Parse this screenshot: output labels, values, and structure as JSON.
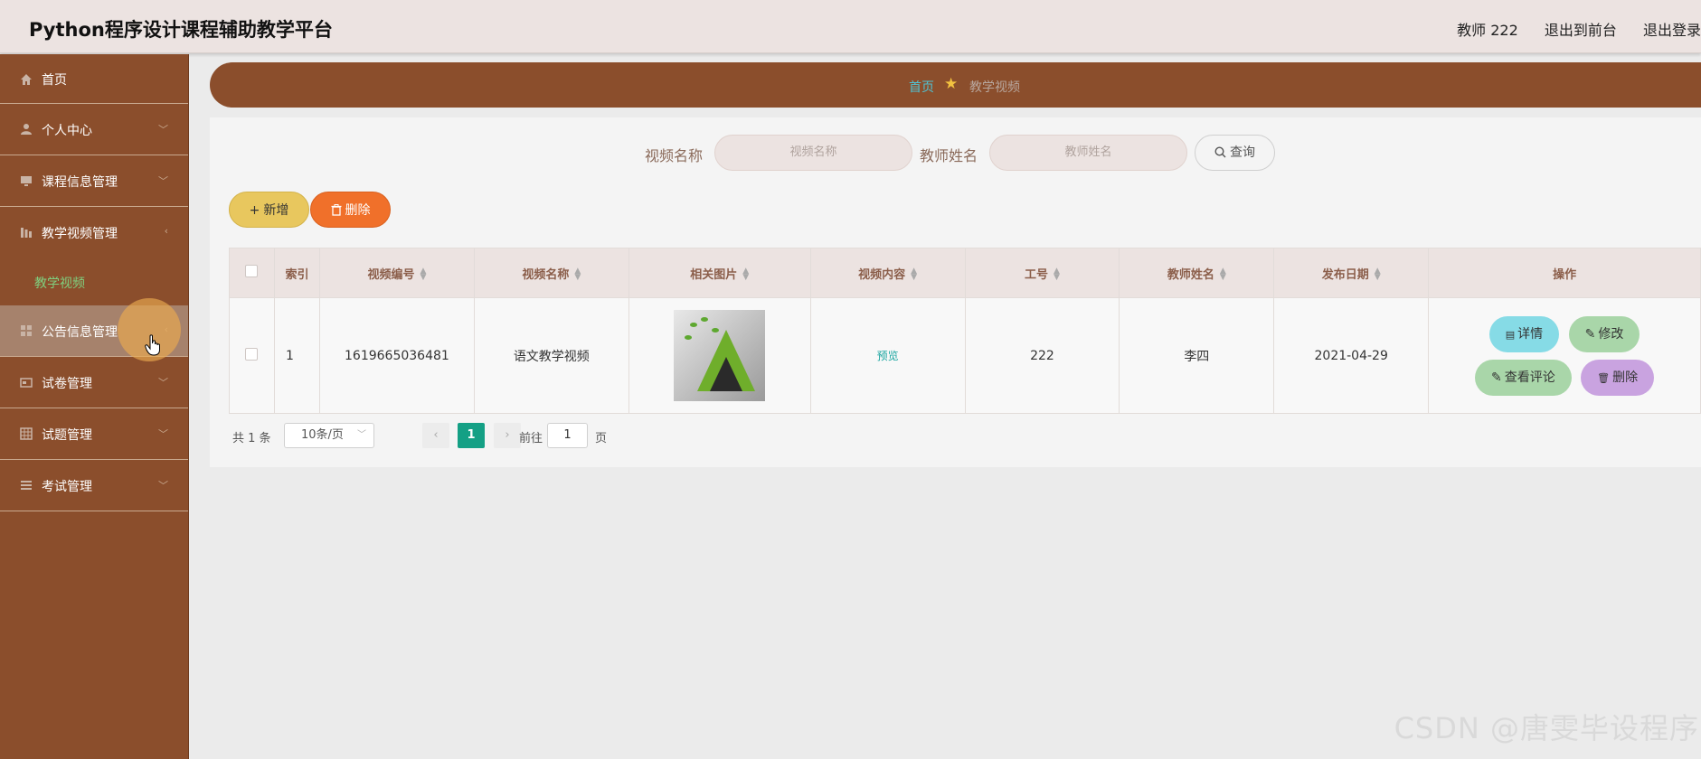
{
  "header": {
    "title": "Python程序设计课程辅助教学平台",
    "user_label": "教师 222",
    "back_link": "退出到前台",
    "logout_link": "退出登录"
  },
  "sidebar": {
    "items": [
      {
        "label": "首页",
        "icon": "home-icon"
      },
      {
        "label": "个人中心",
        "icon": "user-icon"
      },
      {
        "label": "课程信息管理",
        "icon": "monitor-icon"
      },
      {
        "label": "教学视频管理",
        "icon": "chart-icon"
      },
      {
        "label": "公告信息管理",
        "icon": "grid-icon"
      },
      {
        "label": "试卷管理",
        "icon": "card-icon"
      },
      {
        "label": "试题管理",
        "icon": "table-icon"
      },
      {
        "label": "考试管理",
        "icon": "list-icon"
      }
    ],
    "active_sub": "教学视频"
  },
  "breadcrumb": {
    "home": "首页",
    "current": "教学视频"
  },
  "search": {
    "video_name_label": "视频名称",
    "video_name_placeholder": "视频名称",
    "teacher_label": "教师姓名",
    "teacher_placeholder": "教师姓名",
    "query_button": "查询"
  },
  "toolbar": {
    "add_label": "新增",
    "delete_label": "删除"
  },
  "table": {
    "columns": [
      "索引",
      "视频编号",
      "视频名称",
      "相关图片",
      "视频内容",
      "工号",
      "教师姓名",
      "发布日期",
      "操作"
    ],
    "rows": [
      {
        "index": "1",
        "video_no": "1619665036481",
        "video_name": "语文教学视频",
        "content_link": "预览",
        "staff_no": "222",
        "teacher": "李四",
        "date": "2021-04-29"
      }
    ],
    "actions": {
      "detail": "详情",
      "edit": "修改",
      "comments": "查看评论",
      "delete": "删除"
    }
  },
  "pagination": {
    "total": "共 1 条",
    "page_size": "10条/页",
    "current_page": "1",
    "goto_label": "前往",
    "goto_value": "1",
    "page_word": "页"
  },
  "watermark": "CSDN @唐雯毕设程序",
  "colors": {
    "sidebar": "#8b4e2c",
    "header": "#ece3e1",
    "accent_green": "#14a085",
    "add": "#e8c75e",
    "delete": "#f0702a"
  }
}
